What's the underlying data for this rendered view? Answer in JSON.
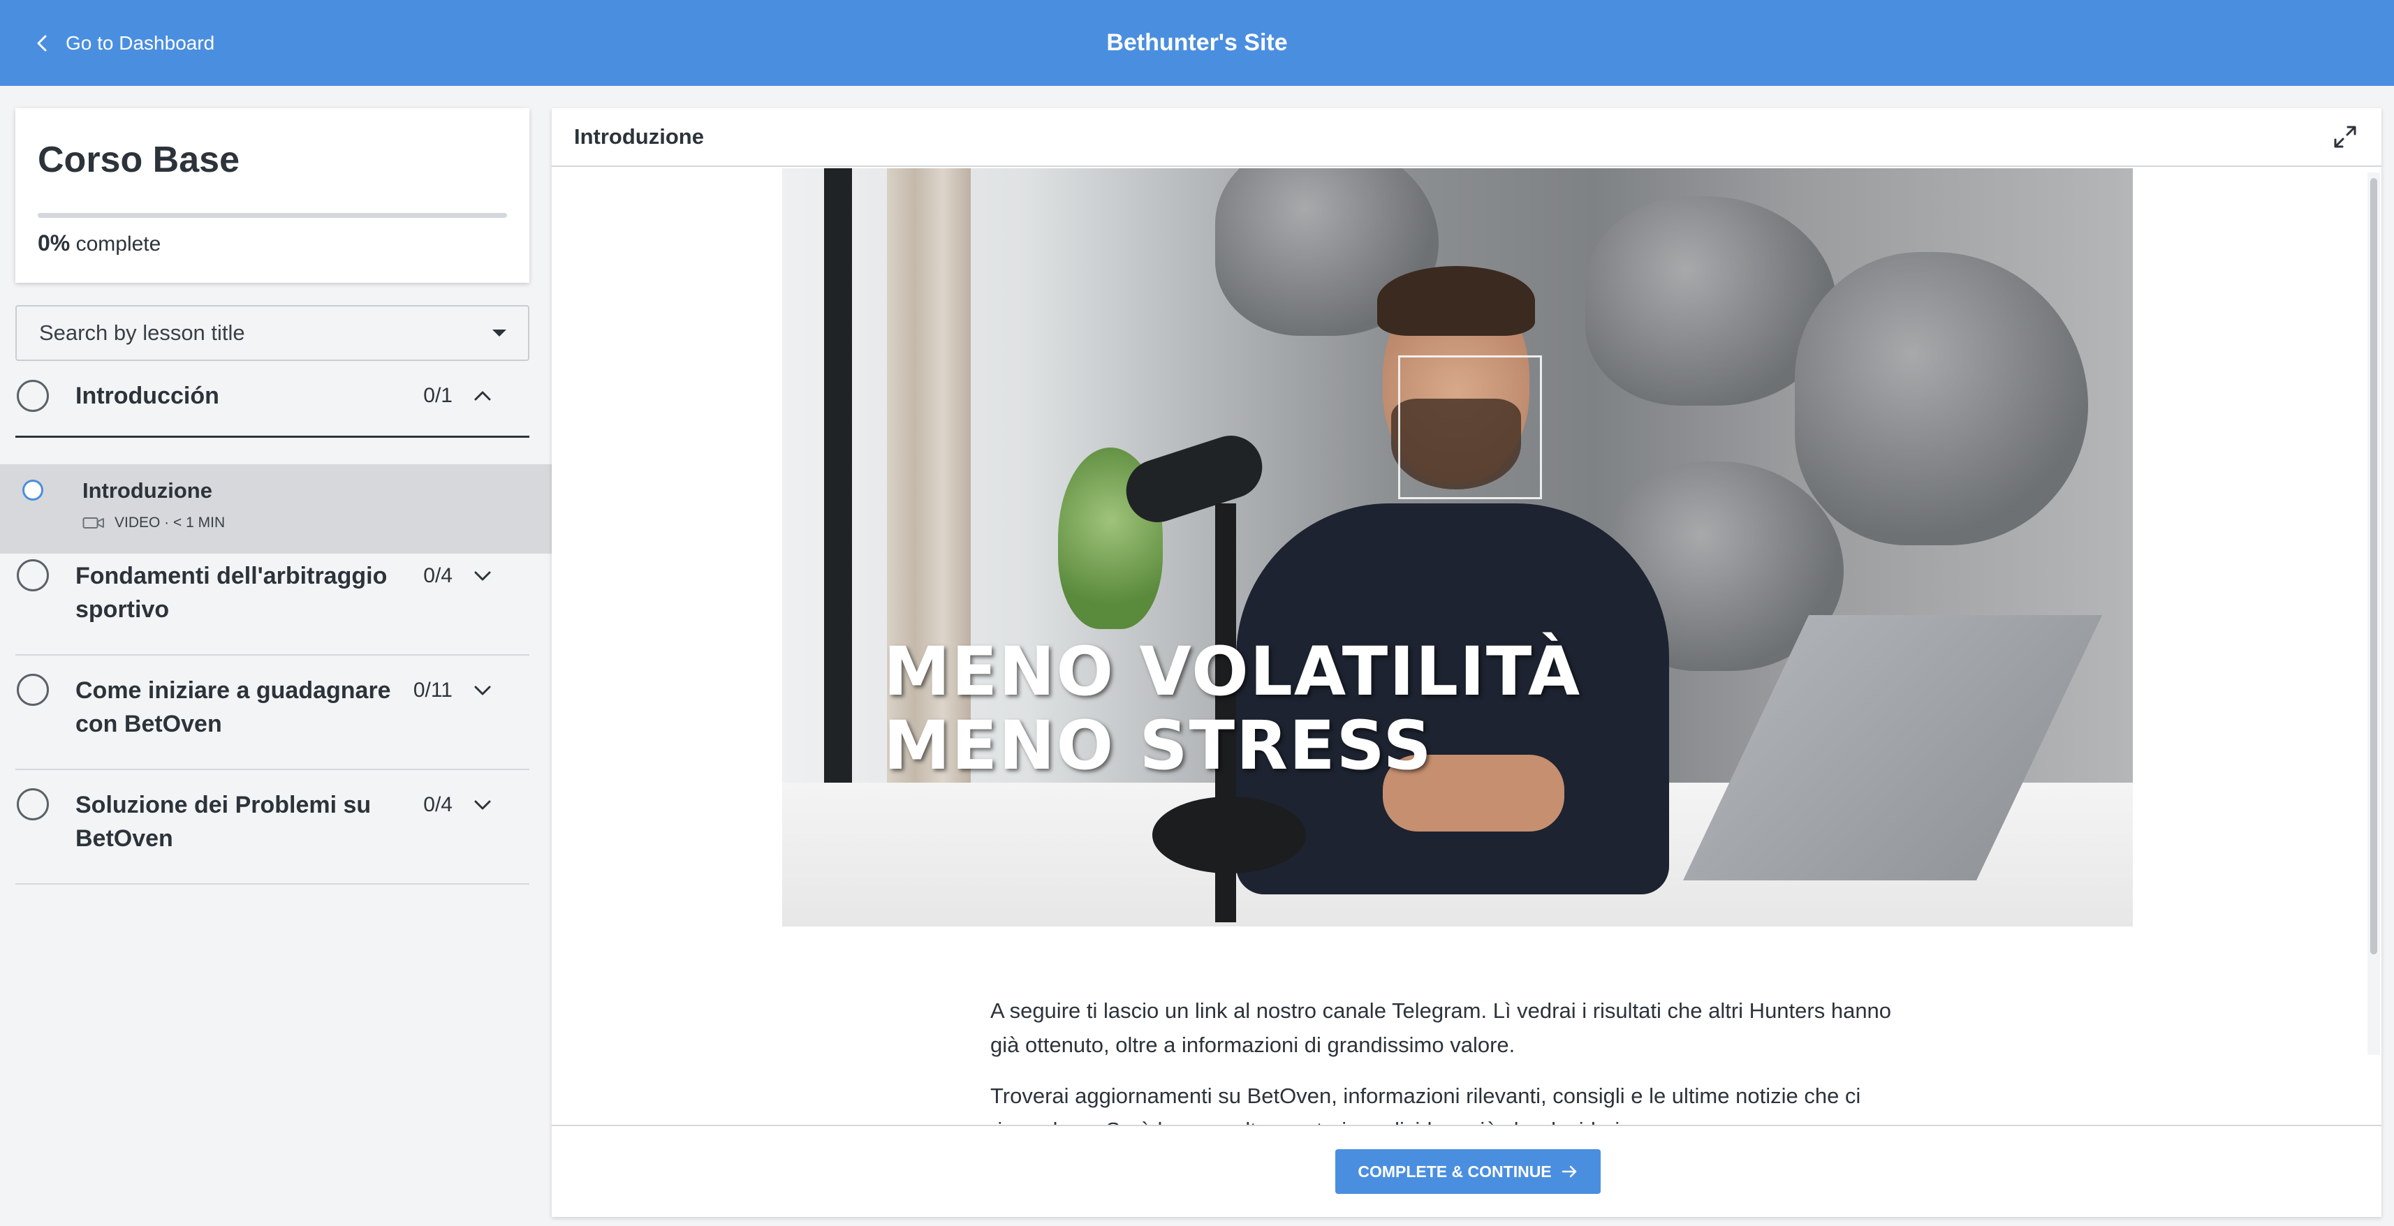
{
  "header": {
    "back_label": "Go to Dashboard",
    "site_title": "Bethunter's Site"
  },
  "course": {
    "title": "Corso Base",
    "progress_percent": 0,
    "progress_value": "0%",
    "progress_suffix": "complete"
  },
  "search": {
    "placeholder": "Search by lesson title"
  },
  "chapters": [
    {
      "title": "Introducción",
      "count": "0/1",
      "expanded": true
    },
    {
      "title": "Fondamenti dell'arbitraggio sportivo",
      "count": "0/4",
      "expanded": false
    },
    {
      "title": "Come iniziare a guadagnare con BetOven",
      "count": "0/11",
      "expanded": false
    },
    {
      "title": "Soluzione dei Problemi su BetOven",
      "count": "0/4",
      "expanded": false
    }
  ],
  "active_lesson": {
    "title": "Introduzione",
    "meta": "VIDEO · < 1 MIN"
  },
  "main": {
    "header_title": "Introduzione",
    "video_overlay_line1": "MENO VOLATILITÀ",
    "video_overlay_line2": "MENO STRESS",
    "paragraph1": "A seguire ti lascio un link al nostro canale Telegram. Lì vedrai i risultati che altri Hunters hanno già ottenuto, oltre a informazioni di grandissimo valore.",
    "paragraph2": "Troverai aggiornamenti su BetOven, informazioni rilevanti, consigli e le ultime notizie che ci riguardano. Sarà ben accolto e potrai condividere ciò che desideri.",
    "continue_label": "COMPLETE & CONTINUE"
  },
  "colors": {
    "brand": "#4a8ee0",
    "sidebar_bg": "#f3f4f6",
    "active_row": "#d6d8db"
  }
}
